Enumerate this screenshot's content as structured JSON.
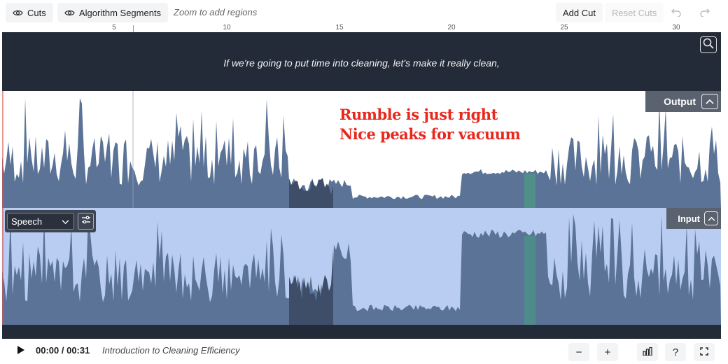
{
  "toolbar": {
    "cuts_label": "Cuts",
    "algorithm_segments_label": "Algorithm Segments",
    "zoom_hint": "Zoom to add regions",
    "add_cut_label": "Add Cut",
    "reset_cuts_label": "Reset Cuts",
    "undo_icon": "undo-icon",
    "redo_icon": "redo-icon"
  },
  "ruler": {
    "ticks": [
      "5",
      "10",
      "15",
      "20",
      "25",
      "30"
    ]
  },
  "subtitle": {
    "text": "If we're going to put time into cleaning, let's make it really clean,"
  },
  "tracks": {
    "output_label": "Output",
    "input_label": "Input"
  },
  "annotation": {
    "line1": "Rumble is just right",
    "line2": "Nice peaks for vacuum"
  },
  "speech_panel": {
    "selected_option": "Speech"
  },
  "transport": {
    "time": "00:00 / 00:31",
    "title": "Introduction to Cleaning Efficiency",
    "zoom_out": "−",
    "zoom_in": "+",
    "help": "?"
  },
  "colors": {
    "dark_band": "#232b38",
    "waveform": "#5b7397",
    "input_background": "#b9cdf2",
    "highlight_segment": "#4f8f88",
    "annotation": "#e8281e"
  }
}
